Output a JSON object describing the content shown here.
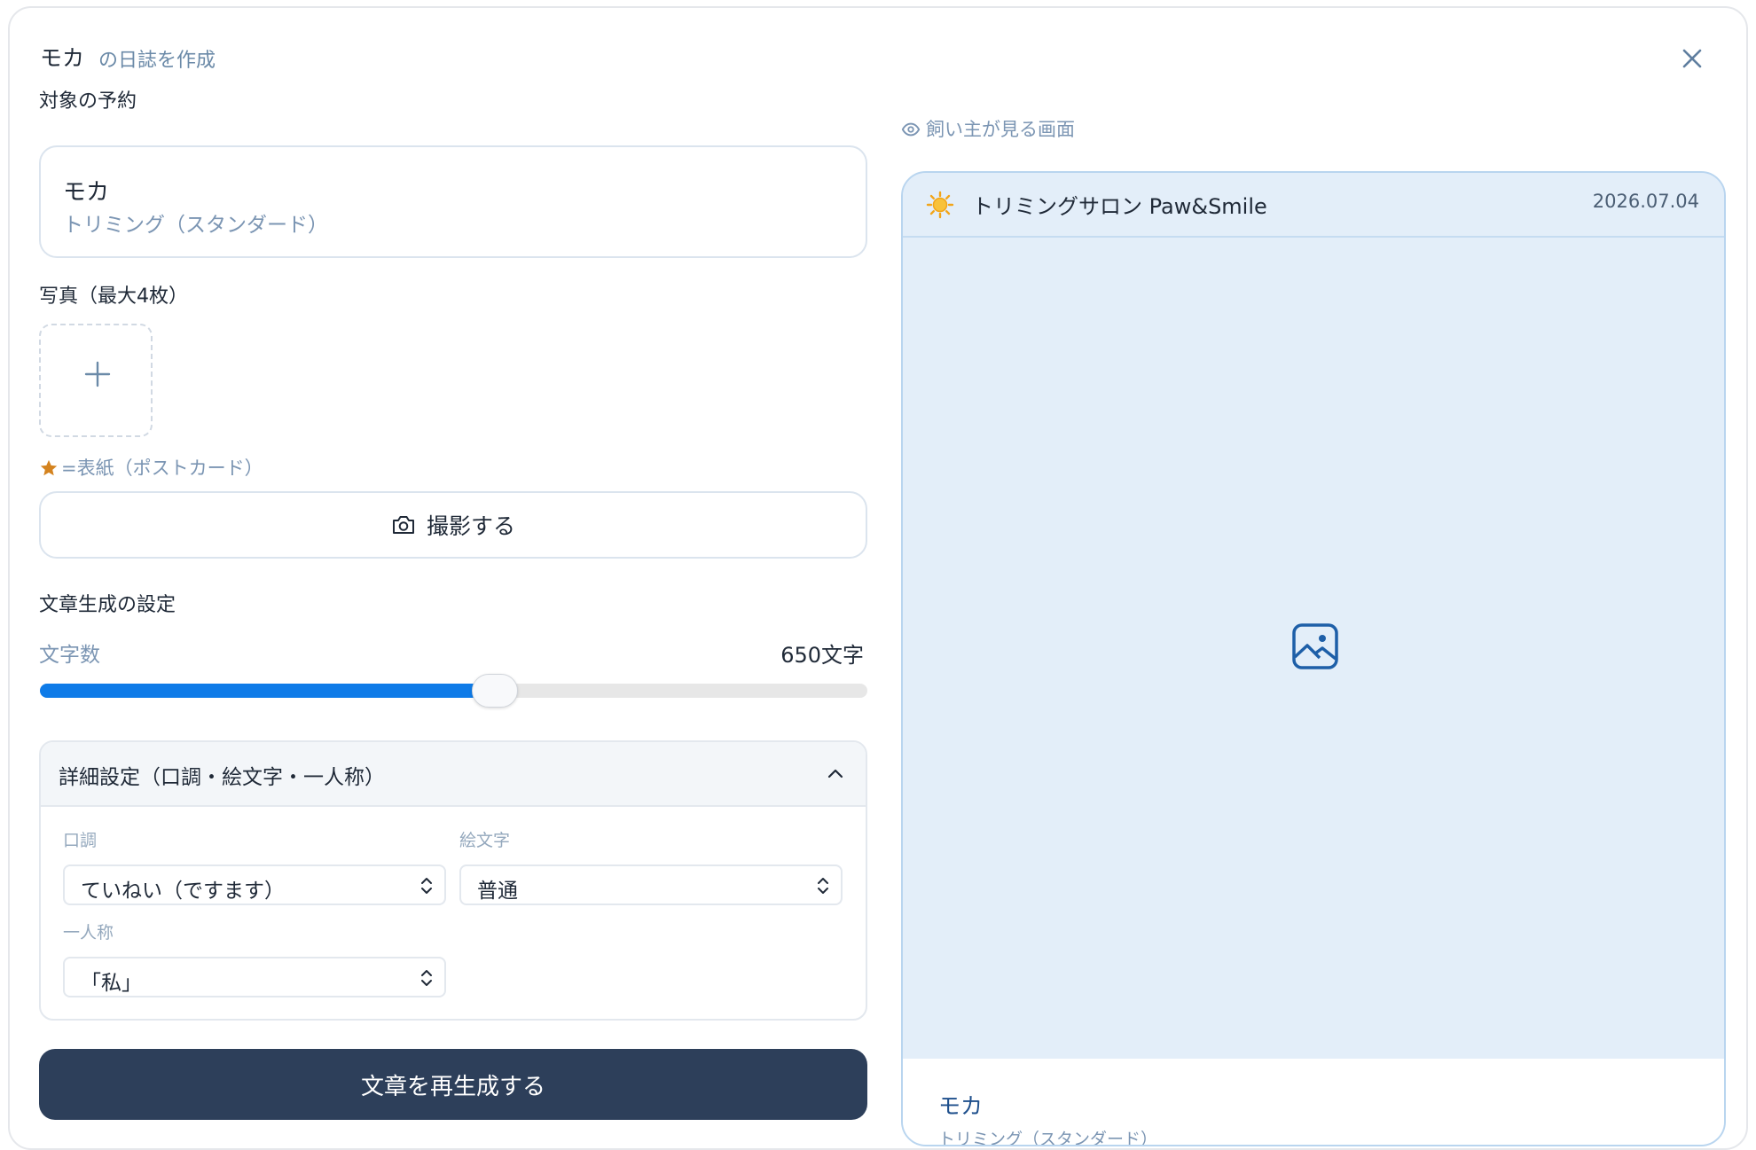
{
  "header": {
    "pet_name": "モカ",
    "title_suffix": "の日誌を作成"
  },
  "target": {
    "label": "対象の予約",
    "pet_name": "モカ",
    "course": "トリミング（スタンダード）"
  },
  "photos": {
    "label": "写真（最大4枚）",
    "cover_note": "=表紙（ポストカード）",
    "capture_label": "撮影する"
  },
  "generation": {
    "section_label": "文章生成の設定",
    "length_label": "文字数",
    "length_value": "650文字",
    "slider_fraction": 0.55,
    "advanced": {
      "title": "詳細設定（口調・絵文字・一人称）",
      "tone_label": "口調",
      "tone_value": "ていねい（ですます）",
      "emoji_label": "絵文字",
      "emoji_value": "普通",
      "first_person_label": "一人称",
      "first_person_value": "「私」"
    },
    "regenerate_label": "文章を再生成する"
  },
  "preview": {
    "label": "飼い主が見る画面",
    "salon_name": "トリミングサロン Paw&Smile",
    "date": "2026.07.04",
    "pet_name": "モカ",
    "course": "トリミング（スタンダード）"
  },
  "colors": {
    "accent": "#0e7be8",
    "primary_button": "#2d3f5a",
    "preview_bg": "#e3eef9",
    "star": "#d4831f"
  }
}
